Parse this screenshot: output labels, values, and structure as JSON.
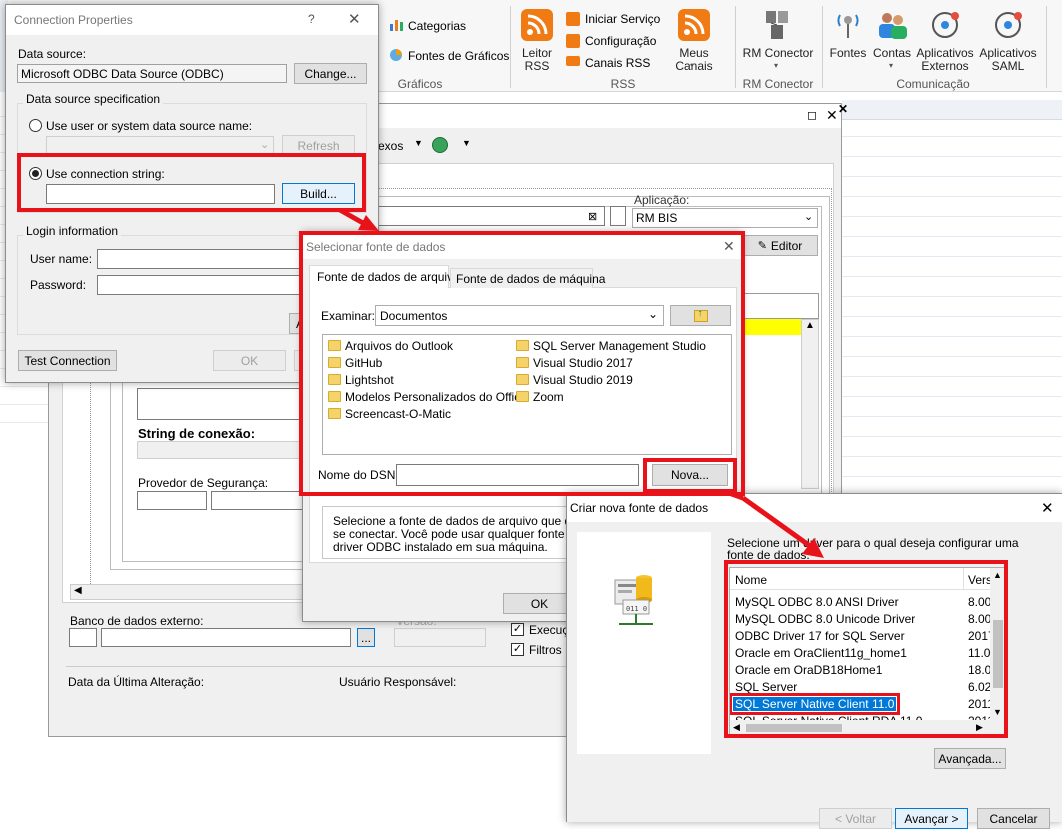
{
  "ribbon": {
    "categorias": "Categorias",
    "fontes_graficos": "Fontes de Gráficos",
    "graficos_group": "Gráficos",
    "leitor_rss": "Leitor\nRSS",
    "iniciar_servico": "Iniciar Serviço",
    "configuracao": "Configuração",
    "canais_rss": "Canais RSS",
    "meus_canais": "Meus Canais",
    "rss_group": "RSS",
    "rm_conector": "RM Conector",
    "rm_conector_group": "RM Conector",
    "fontes": "Fontes",
    "contas": "Contas",
    "aplicativos_externos": "Aplicativos\nExternos",
    "aplicativos_saml": "Aplicativos\nSAML",
    "comunicacao_group": "Comunicação"
  },
  "bg_window": {
    "toolbar_text": "exos",
    "aplicacao_label": "Aplicação:",
    "aplicacao_value": "RM BIS",
    "editor_button": "Editor",
    "string_conexao_label": "String de conexão:",
    "provedor_seguranca_label": "Provedor de Segurança:",
    "banco_externo_label": "Banco de dados externo:",
    "versao_label": "Versão:",
    "execucao_label": "Execuç",
    "filtros_label": "Filtros",
    "data_alteracao_label": "Data da Última Alteração:",
    "usuario_responsavel_label": "Usuário Responsável:",
    "browse_button": "..."
  },
  "connection_properties": {
    "title": "Connection Properties",
    "help": "?",
    "data_source_label": "Data source:",
    "data_source_value": "Microsoft ODBC Data Source (ODBC)",
    "change_button": "Change...",
    "spec_group": "Data source specification",
    "use_dsn_label": "Use user or system data source name:",
    "refresh_button": "Refresh",
    "use_connstr_label": "Use connection string:",
    "build_button": "Build...",
    "login_group": "Login information",
    "username_label": "User name:",
    "password_label": "Password:",
    "adv_button_partial": "A",
    "test_connection_button": "Test Connection",
    "ok_button": "OK"
  },
  "select_datasource": {
    "title": "Selecionar fonte de dados",
    "tab_file": "Fonte de dados de arquivo",
    "tab_machine": "Fonte de dados de máquina",
    "examinar_label": "Examinar:",
    "examinar_value": "Documentos",
    "folders_col1": [
      "Arquivos do Outlook",
      "GitHub",
      "Lightshot",
      "Modelos Personalizados do Office",
      "Screencast-O-Matic"
    ],
    "folders_col2": [
      "SQL Server Management Studio",
      "Visual Studio 2017",
      "Visual Studio 2019",
      "Zoom"
    ],
    "dsn_label": "Nome do DSN:",
    "nova_button": "Nova...",
    "description": "Selecione a fonte de dados de arquivo que descr\nse conectar. Você pode usar qualquer fonte de d\ndriver ODBC instalado em sua máquina.",
    "ok_button": "OK"
  },
  "new_datasource": {
    "title": "Criar nova fonte de dados",
    "instruction": "Selecione um driver para o qual deseja configurar uma\nfonte de dados.",
    "col_name": "Nome",
    "col_version": "Vers",
    "drivers": [
      {
        "name": "MySQL ODBC 8.0 ANSI Driver",
        "version": "8.00"
      },
      {
        "name": "MySQL ODBC 8.0 Unicode Driver",
        "version": "8.00"
      },
      {
        "name": "ODBC Driver 17 for SQL Server",
        "version": "2017"
      },
      {
        "name": "Oracle em OraClient11g_home1",
        "version": "11.0"
      },
      {
        "name": "Oracle em OraDB18Home1",
        "version": "18.0"
      },
      {
        "name": "SQL Server",
        "version": "6.02"
      },
      {
        "name": "SQL Server Native Client 11.0",
        "version": "2011"
      },
      {
        "name": "SQL Server Native Client RDA 11.0",
        "version": "2011"
      }
    ],
    "selected_index": 6,
    "avancada_button": "Avançada...",
    "voltar_button": "< Voltar",
    "avancar_button": "Avançar >",
    "cancelar_button": "Cancelar"
  },
  "colors": {
    "highlight_red": "#e8121a",
    "selection_blue": "#0078d7",
    "yellow_row": "#ffff00"
  }
}
